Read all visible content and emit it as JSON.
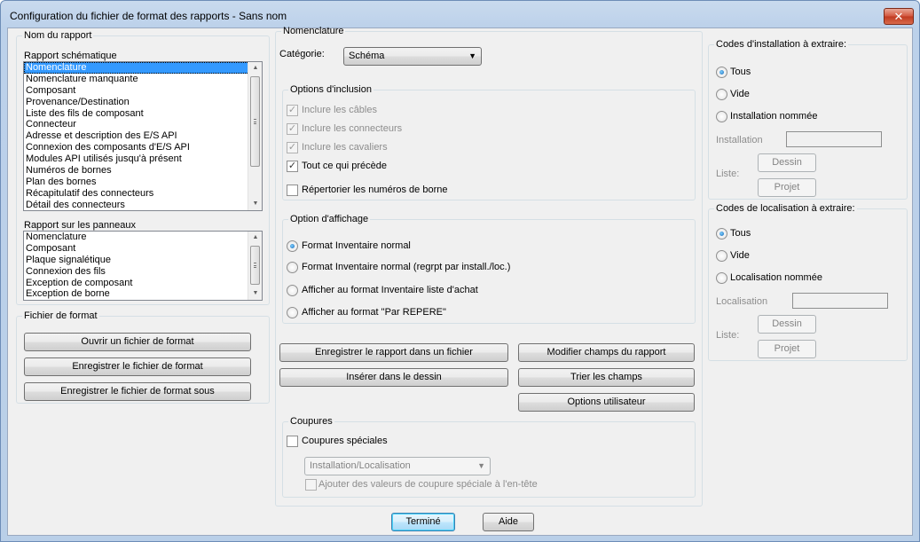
{
  "window": {
    "title": "Configuration du fichier de format des rapports - Sans nom",
    "close_glyph": "✕"
  },
  "report_name": {
    "legend": "Nom du rapport",
    "schematic_label": "Rapport schématique",
    "schematic_items": [
      "Nomenclature",
      "Nomenclature manquante",
      "Composant",
      "Provenance/Destination",
      "Liste des fils de composant",
      "Connecteur",
      "Adresse et description des E/S API",
      "Connexion des composants d'E/S API",
      "Modules API utilisés jusqu'à présent",
      "Numéros de bornes",
      "Plan des bornes",
      "Récapitulatif des connecteurs",
      "Détail des connecteurs"
    ],
    "schematic_selected": "Nomenclature",
    "panel_label": "Rapport sur les panneaux",
    "panel_items": [
      "Nomenclature",
      "Composant",
      "Plaque signalétique",
      "Connexion des fils",
      "Exception de composant",
      "Exception de borne"
    ]
  },
  "format_file": {
    "legend": "Fichier de format",
    "open_label": "Ouvrir un fichier de format",
    "save_label": "Enregistrer le fichier de format",
    "save_as_label": "Enregistrer le fichier de format sous"
  },
  "nomenclature": {
    "legend": "Nomenclature",
    "category_label": "Catégorie:",
    "category_value": "Schéma",
    "inclusion": {
      "legend": "Options d'inclusion",
      "cables": "Inclure les câbles",
      "connectors": "Inclure les connecteurs",
      "jumpers": "Inclure les cavaliers",
      "all_above": "Tout ce qui précède",
      "terminal_numbers": "Répertorier les numéros de borne"
    },
    "display": {
      "legend": "Option d'affichage",
      "normal": "Format Inventaire normal",
      "normal_grouped": "Format Inventaire normal (regrpt par install./loc.)",
      "purchase_list": "Afficher au format Inventaire liste d'achat",
      "by_tag": "Afficher au format \"Par REPERE\""
    }
  },
  "actions": {
    "save_report": "Enregistrer le rapport dans un fichier",
    "edit_fields": "Modifier champs du rapport",
    "insert_drawing": "Insérer dans le dessin",
    "sort_fields": "Trier les champs",
    "user_options": "Options utilisateur"
  },
  "breaks": {
    "legend": "Coupures",
    "special": "Coupures spéciales",
    "combo_value": "Installation/Localisation",
    "add_header": "Ajouter des valeurs de coupure spéciale à l'en-tête"
  },
  "installation_codes": {
    "legend": "Codes d'installation à extraire:",
    "all": "Tous",
    "empty": "Vide",
    "named": "Installation nommée",
    "field_label": "Installation",
    "list_label": "Liste:",
    "drawing_btn": "Dessin",
    "project_btn": "Projet"
  },
  "location_codes": {
    "legend": "Codes de localisation à extraire:",
    "all": "Tous",
    "empty": "Vide",
    "named": "Localisation nommée",
    "field_label": "Localisation",
    "list_label": "Liste:",
    "drawing_btn": "Dessin",
    "project_btn": "Projet"
  },
  "footer": {
    "done": "Terminé",
    "help": "Aide"
  },
  "icons": {
    "check_mark": "✓",
    "arrow_up": "▲",
    "arrow_down": "▼"
  }
}
